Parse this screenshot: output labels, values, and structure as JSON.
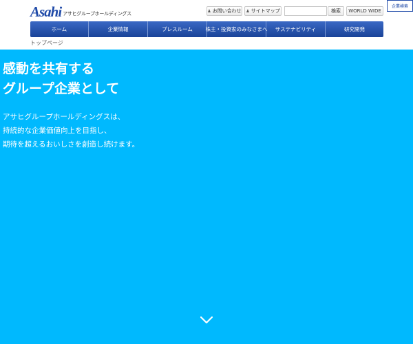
{
  "header": {
    "logo_mark": "Asahi",
    "logo_sub": "アサヒグループホールディングス",
    "contact_label": "お問い合わせ",
    "sitemap_label": "サイトマップ",
    "search_placeholder": "",
    "search_button": "検索",
    "world_wide": "WORLD WIDE",
    "calendar_link": "企業検索"
  },
  "nav": {
    "items": [
      {
        "label": "ホーム"
      },
      {
        "label": "企業情報"
      },
      {
        "label": "プレスルーム"
      },
      {
        "label": "株主・投資家のみなさまへ"
      },
      {
        "label": "サステナビリティ"
      },
      {
        "label": "研究開発"
      }
    ]
  },
  "breadcrumb": "トップページ",
  "hero": {
    "title_lines": [
      "感動を共有する",
      "グループ企業として"
    ],
    "text_lines": [
      "アサヒグループホールディングスは、",
      "持続的な企業価値向上を目指し、",
      "期待を超えるおいしさを創造し続けます。"
    ],
    "bg_color": "#00b9fe"
  },
  "icons": {
    "contact": "person-icon",
    "sitemap": "person-icon",
    "scroll": "chevron-down-icon"
  }
}
